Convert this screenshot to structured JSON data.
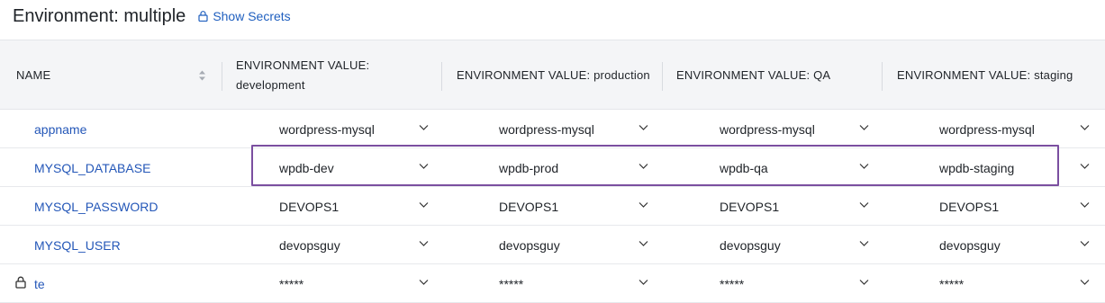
{
  "header": {
    "title": "Environment: multiple",
    "show_secrets_label": "Show Secrets"
  },
  "columns": {
    "name": "NAME",
    "values": [
      "ENVIRONMENT VALUE: development",
      "ENVIRONMENT VALUE: production",
      "ENVIRONMENT VALUE: QA",
      "ENVIRONMENT VALUE: staging"
    ]
  },
  "rows": [
    {
      "name": "appname",
      "secret": false,
      "values": [
        "wordpress-mysql",
        "wordpress-mysql",
        "wordpress-mysql",
        "wordpress-mysql"
      ]
    },
    {
      "name": "MYSQL_DATABASE",
      "secret": false,
      "values": [
        "wpdb-dev",
        "wpdb-prod",
        "wpdb-qa",
        "wpdb-staging"
      ]
    },
    {
      "name": "MYSQL_PASSWORD",
      "secret": false,
      "values": [
        "DEVOPS1",
        "DEVOPS1",
        "DEVOPS1",
        "DEVOPS1"
      ]
    },
    {
      "name": "MYSQL_USER",
      "secret": false,
      "values": [
        "devopsguy",
        "devopsguy",
        "devopsguy",
        "devopsguy"
      ]
    },
    {
      "name": "te",
      "secret": true,
      "values": [
        "*****",
        "*****",
        "*****",
        "*****"
      ]
    }
  ],
  "icons": {
    "show_secrets": "lock-icon",
    "sort": "sort-icon",
    "value_dropdown": "chevron-down-icon",
    "secret_row": "lock-icon"
  },
  "colors": {
    "link": "#2457b8",
    "highlight_border": "#7b4fa0",
    "header_bg": "#f4f5f7"
  }
}
